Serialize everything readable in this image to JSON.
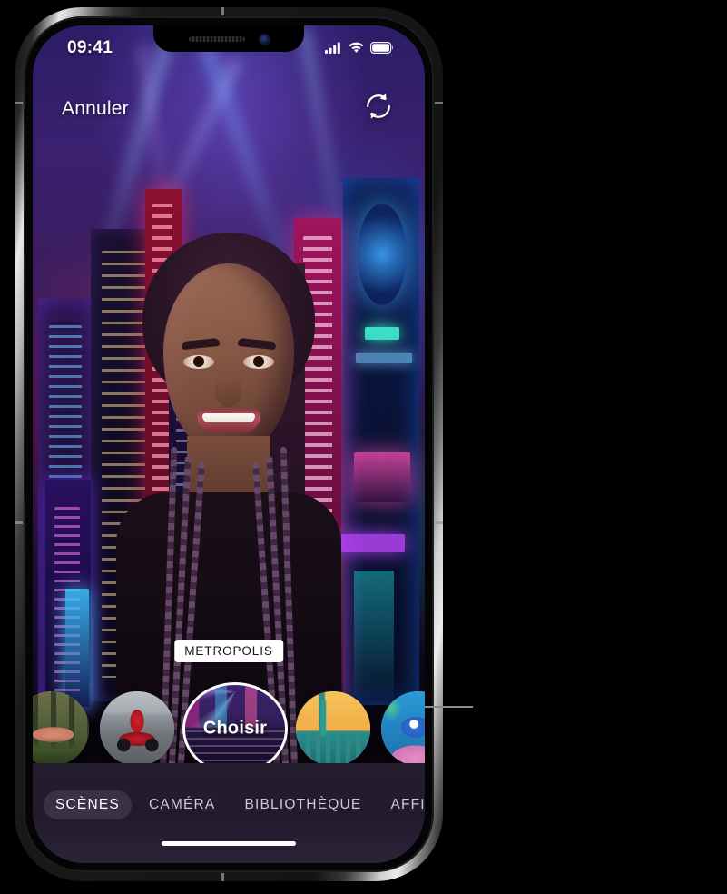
{
  "status_bar": {
    "time": "09:41",
    "cellular_icon": "signal-bars-icon",
    "wifi_icon": "wifi-icon",
    "battery_icon": "battery-full-icon"
  },
  "header": {
    "cancel_label": "Annuler",
    "flip_camera_icon": "camera-flip-icon"
  },
  "viewfinder": {
    "active_scene_name": "METROPOLIS",
    "choose_label": "Choisir"
  },
  "scenes": [
    {
      "name": "Forest Deer",
      "selected": false,
      "partial": "left"
    },
    {
      "name": "Motorcycle",
      "selected": false,
      "partial": "none"
    },
    {
      "name": "Metropolis",
      "selected": true,
      "partial": "none"
    },
    {
      "name": "Bridge",
      "selected": false,
      "partial": "none"
    },
    {
      "name": "Underwater",
      "selected": false,
      "partial": "right"
    }
  ],
  "tabs": [
    {
      "label": "SCÈNES",
      "active": true
    },
    {
      "label": "CAMÉRA",
      "active": false
    },
    {
      "label": "BIBLIOTHÈQUE",
      "active": false
    },
    {
      "label": "AFFICHES",
      "active": false
    }
  ],
  "colors": {
    "accent_white": "#ffffff",
    "tab_bar_bg": "#241d2e",
    "tab_active_bg": "#3a3147",
    "tab_inactive_text": "#cfc8d6",
    "scene_label_bg": "#ffffff",
    "scene_label_text": "#171717",
    "callout_line": "#8c8c8c"
  }
}
